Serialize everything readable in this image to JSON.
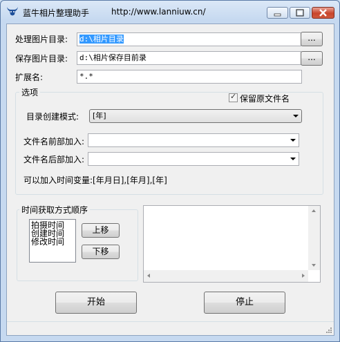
{
  "window": {
    "title": "蓝牛相片整理助手",
    "url": "http://www.lanniuw.cn/"
  },
  "form": {
    "source_label": "处理图片目录:",
    "source_value": "d:\\相片目录",
    "source_browse": "...",
    "save_label": "保存图片目录:",
    "save_value": "d:\\相片保存目前录",
    "save_browse": "...",
    "ext_label": "扩展名:",
    "ext_value": "*.*"
  },
  "options": {
    "group_title": "选项",
    "keep_name_label": "保留原文件名",
    "keep_name_checked": true,
    "mode_label": "目录创建模式:",
    "mode_value": "[年]",
    "prefix_label": "文件名前部加入:",
    "prefix_value": "",
    "suffix_label": "文件名后部加入:",
    "suffix_value": "",
    "hint": "可以加入时间变量:[年月日],[年月],[年]"
  },
  "time_order": {
    "group_title": "时间获取方式顺序",
    "items": [
      "拍摄时间",
      "创建时间",
      "修改时间"
    ],
    "up_button": "上移",
    "down_button": "下移"
  },
  "actions": {
    "start_button": "开始",
    "stop_button": "停止"
  },
  "icons": {
    "app": "bull-head-icon",
    "minimize": "minimize-icon",
    "maximize": "maximize-icon",
    "close": "close-icon"
  }
}
